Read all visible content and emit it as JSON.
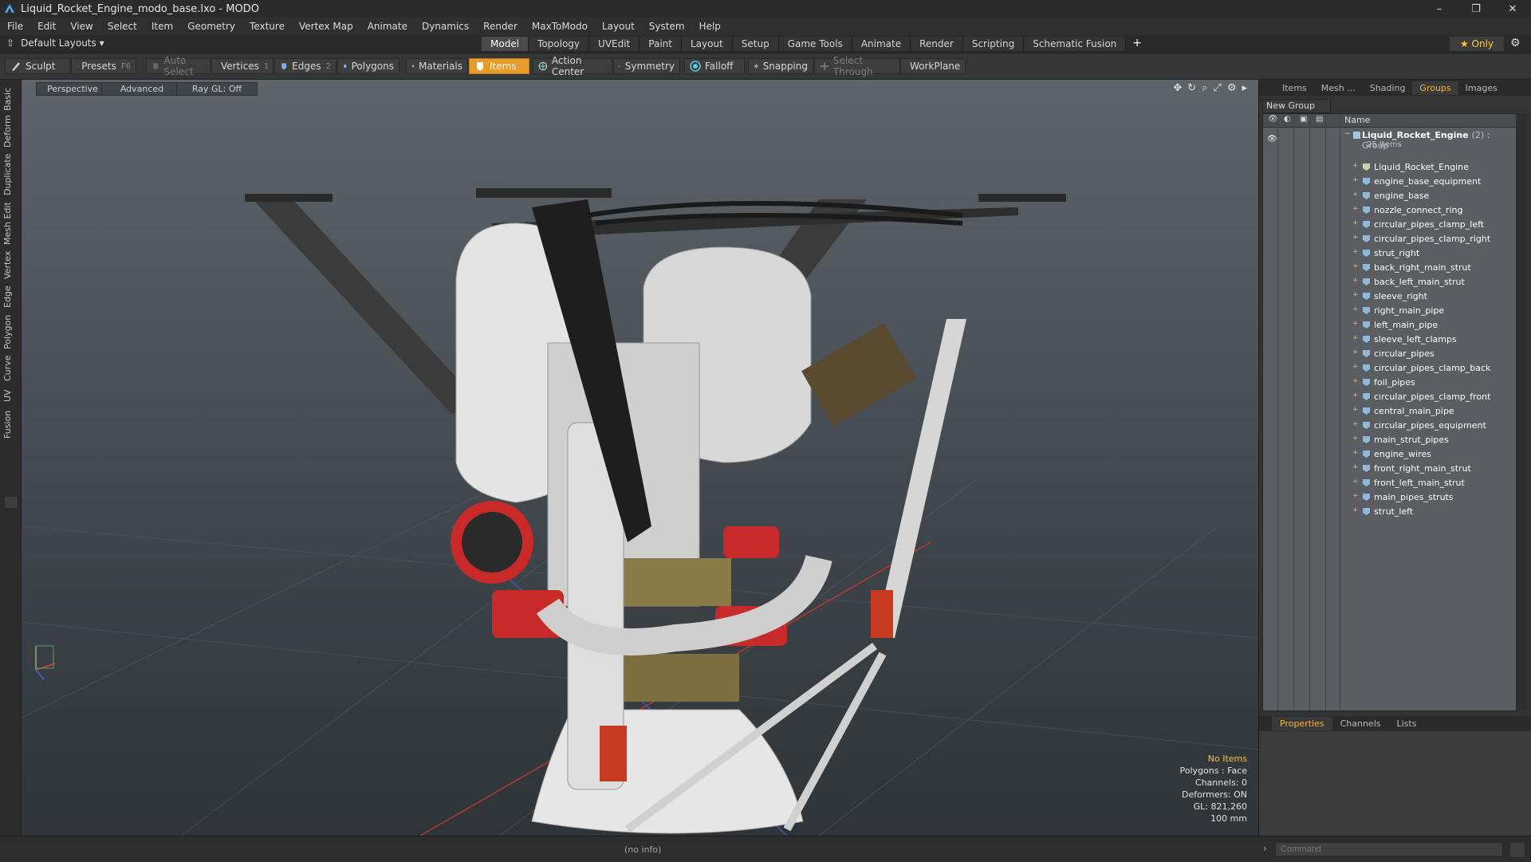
{
  "window": {
    "title": "Liquid_Rocket_Engine_modo_base.lxo - MODO",
    "controls": {
      "minimize": "–",
      "maximize": "❐",
      "close": "✕"
    }
  },
  "menu": [
    "File",
    "Edit",
    "View",
    "Select",
    "Item",
    "Geometry",
    "Texture",
    "Vertex Map",
    "Animate",
    "Dynamics",
    "Render",
    "MaxToModo",
    "Layout",
    "System",
    "Help"
  ],
  "layouts": {
    "current": "Default Layouts ▾",
    "tabs": [
      "Model",
      "Topology",
      "UVEdit",
      "Paint",
      "Layout",
      "Setup",
      "Game Tools",
      "Animate",
      "Render",
      "Scripting",
      "Schematic Fusion"
    ],
    "active_tab": "Model",
    "add": "+",
    "only_label": "★  Only"
  },
  "toolbar": {
    "sculpt": "Sculpt",
    "presets": "Presets",
    "presets_key": "F6",
    "auto_select": "Auto Select",
    "vertices": "Vertices",
    "vertices_key": "1",
    "edges": "Edges",
    "edges_key": "2",
    "polygons": "Polygons",
    "materials": "Materials",
    "items": "Items",
    "action_center": "Action Center",
    "symmetry": "Symmetry",
    "falloff": "Falloff",
    "snapping": "Snapping",
    "select_through": "Select Through",
    "workplane": "WorkPlane"
  },
  "left_tabs": [
    "Basic",
    "Deform",
    "Duplicate",
    "Mesh Edit",
    "Vertex",
    "Edge",
    "Polygon",
    "Curve",
    "UV",
    "Fusion"
  ],
  "viewport": {
    "view": "Perspective",
    "shading": "Advanced",
    "raygl": "Ray GL: Off",
    "icons": [
      "move-icon",
      "rotate-icon",
      "zoom-icon",
      "fit-icon",
      "settings-icon",
      "more-icon"
    ],
    "info": {
      "selection": "No Items",
      "polygons": "Polygons : Face",
      "channels": "Channels: 0",
      "deformers": "Deformers: ON",
      "gl": "GL: 821,260",
      "units": "100 mm"
    }
  },
  "right_panel": {
    "tabs": [
      "Items",
      "Mesh ...",
      "Shading",
      "Groups",
      "Images"
    ],
    "active_tab": "Groups",
    "new_group": "New Group",
    "column_name": "Name",
    "group": {
      "name": "Liquid_Rocket_Engine",
      "count": "(2) : Group",
      "items_count": "25 Items"
    },
    "items": [
      "Liquid_Rocket_Engine",
      "engine_base_equipment",
      "engine_base",
      "nozzle_connect_ring",
      "circular_pipes_clamp_left",
      "circular_pipes_clamp_right",
      "strut_right",
      "back_right_main_strut",
      "back_left_main_strut",
      "sleeve_right",
      "right_main_pipe",
      "left_main_pipe",
      "sleeve_left_clamps",
      "circular_pipes",
      "circular_pipes_clamp_back",
      "foil_pipes",
      "circular_pipes_clamp_front",
      "central_main_pipe",
      "circular_pipes_equipment",
      "main_strut_pipes",
      "engine_wires",
      "front_right_main_strut",
      "front_left_main_strut",
      "main_pipes_struts",
      "strut_left"
    ],
    "bottom_tabs": [
      "Properties",
      "Channels",
      "Lists"
    ],
    "bottom_active": "Properties"
  },
  "status": {
    "info": "(no info)",
    "command_placeholder": "Command"
  },
  "colors": {
    "accent": "#e89a2a",
    "active_tab_text": "#f2b63a",
    "viewport_top": "#5d646a",
    "viewport_bottom": "#2f3438"
  }
}
